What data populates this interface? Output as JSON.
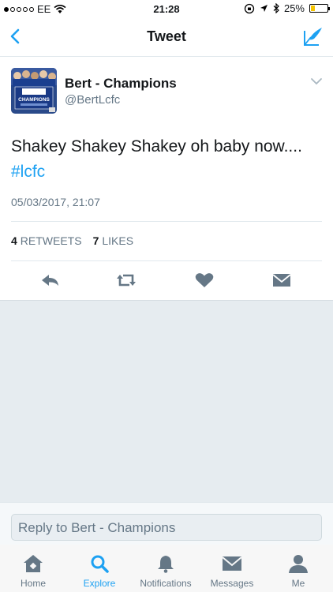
{
  "status_bar": {
    "carrier": "EE",
    "time": "21:28",
    "battery": "25%",
    "battery_level": 0.25
  },
  "navbar": {
    "title": "Tweet",
    "back_icon": "chevron-left-icon",
    "compose_icon": "compose-feather-icon"
  },
  "tweet": {
    "author_name": "Bert - Champions",
    "author_handle": "@BertLcfc",
    "avatar_badge_text": "CHAMPIONS",
    "text": "Shakey Shakey Shakey oh baby now....",
    "hashtag": "#lcfc",
    "timestamp": "05/03/2017, 21:07",
    "retweets_count": "4",
    "retweets_label": "RETWEETS",
    "likes_count": "7",
    "likes_label": "LIKES"
  },
  "actions": [
    {
      "icon": "reply-icon"
    },
    {
      "icon": "retweet-icon"
    },
    {
      "icon": "like-heart-icon"
    },
    {
      "icon": "direct-message-icon"
    }
  ],
  "reply": {
    "placeholder": "Reply to Bert - Champions"
  },
  "tabbar": {
    "home": "Home",
    "explore": "Explore",
    "notifications": "Notifications",
    "messages": "Messages",
    "me": "Me"
  },
  "colors": {
    "accent": "#1da1f2",
    "secondary_text": "#657786",
    "background_grey": "#e6ecf0",
    "battery_yellow": "#f5c400"
  }
}
